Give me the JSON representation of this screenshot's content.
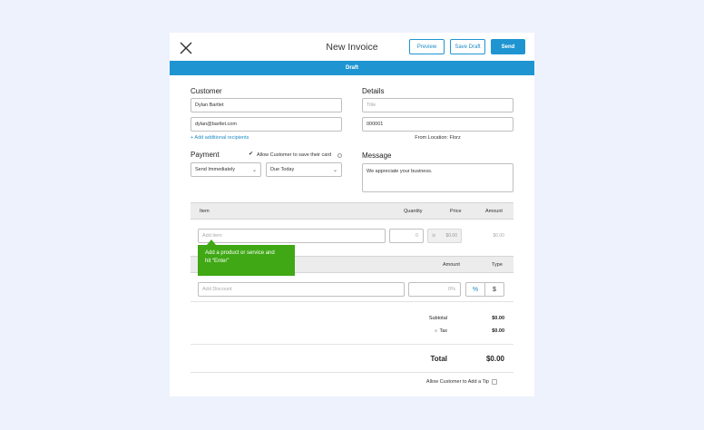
{
  "header": {
    "title": "New Invoice",
    "preview_label": "Preview",
    "save_draft_label": "Save Draft",
    "send_label": "Send"
  },
  "status_bar": {
    "label": "Draft"
  },
  "customer": {
    "section_label": "Customer",
    "name": "Dylan Bartlet",
    "email": "dylan@bartlet.com",
    "add_recipients_link": "+ Add additional recipients"
  },
  "details": {
    "section_label": "Details",
    "title_placeholder": "Title",
    "invoice_number": "000001",
    "from_location": "From Location: Florz"
  },
  "payment": {
    "section_label": "Payment",
    "allow_save_card_label": "Allow Customer to save their card",
    "allow_save_card_checked": true,
    "send_option": "Send Immediately",
    "due_option": "Due Today"
  },
  "message": {
    "section_label": "Message",
    "text": "We appreciate your business."
  },
  "items_table": {
    "columns": [
      "Item",
      "Quantity",
      "Price",
      "Amount"
    ],
    "item_placeholder": "Add item",
    "quantity_value": "0",
    "price_value": "$0.00",
    "amount_value": "$0.00"
  },
  "tooltip": {
    "line1": "Add a product or service and",
    "line2": "hit “Enter”"
  },
  "discount_table": {
    "columns": [
      "Amount",
      "Type"
    ],
    "discount_placeholder": "Add Discount",
    "amount_placeholder": "0%",
    "percent_label": "%",
    "dollar_label": "$"
  },
  "summary": {
    "subtotal_label": "Subtotal",
    "subtotal_value": "$0.00",
    "tax_label": "Tax",
    "tax_value": "$0.00",
    "total_label": "Total",
    "total_value": "$0.00"
  },
  "tip": {
    "label": "Allow Customer to Add a Tip",
    "checked": false
  },
  "colors": {
    "accent": "#1e95d1",
    "tooltip": "#3fa814",
    "background": "#eef2fd"
  }
}
